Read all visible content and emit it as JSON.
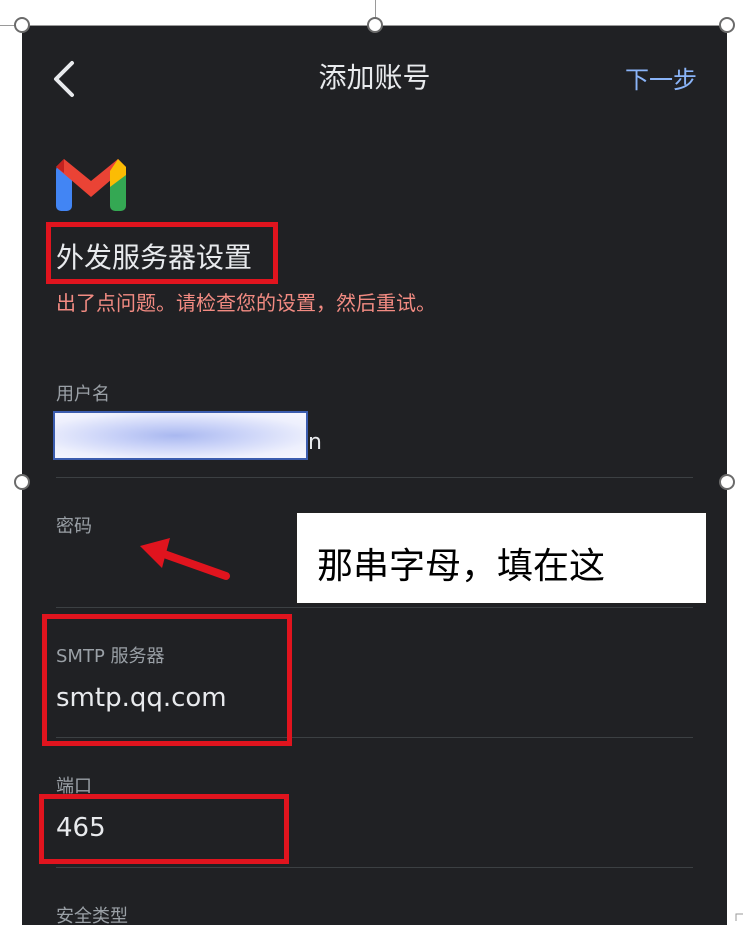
{
  "header": {
    "back_icon": "chevron-left-icon",
    "title": "添加账号",
    "next_label": "下一步"
  },
  "logo": {
    "icon": "gmail-logo"
  },
  "section": {
    "title": "外发服务器设置",
    "error": "出了点问题。请检查您的设置，然后重试。"
  },
  "fields": {
    "username": {
      "label": "用户名",
      "value_tail": "n"
    },
    "password": {
      "label": "密码",
      "value": ""
    },
    "smtp": {
      "label": "SMTP 服务器",
      "value": "smtp.qq.com"
    },
    "port": {
      "label": "端口",
      "value": "465"
    },
    "security": {
      "label": "安全类型"
    }
  },
  "annotation": {
    "callout_text": "那串字母，填在这",
    "highlight_color": "#e0141e",
    "arrow_icon": "red-arrow-icon"
  },
  "colors": {
    "background": "#202124",
    "text": "#e8eaed",
    "label": "#9aa0a6",
    "link": "#8ab4f8",
    "error": "#f28b82"
  }
}
